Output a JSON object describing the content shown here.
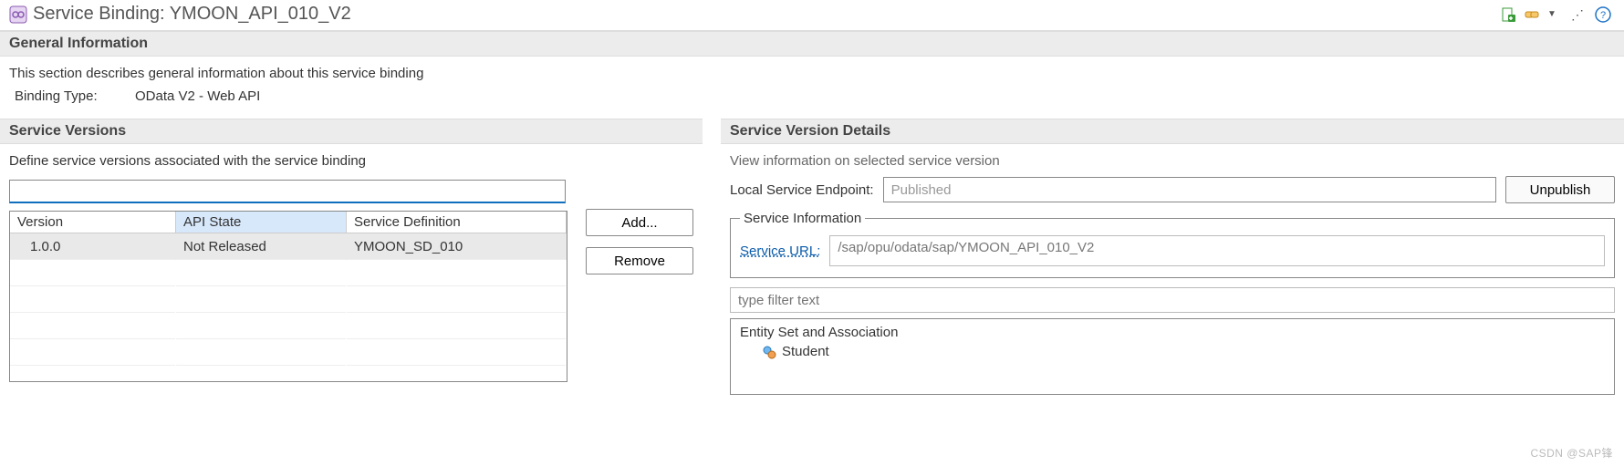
{
  "header": {
    "title": "Service Binding: YMOON_API_010_V2"
  },
  "general": {
    "section_title": "General Information",
    "description": "This section describes general information about this service binding",
    "binding_type_label": "Binding Type:",
    "binding_type_value": "OData V2 - Web API"
  },
  "versions": {
    "section_title": "Service Versions",
    "description": "Define service versions associated with the service binding",
    "filter_value": "",
    "columns": {
      "version": "Version",
      "api_state": "API State",
      "service_def": "Service Definition"
    },
    "rows": [
      {
        "version": "1.0.0",
        "api_state": "Not Released",
        "service_def": "YMOON_SD_010"
      }
    ],
    "add_label": "Add...",
    "remove_label": "Remove"
  },
  "details": {
    "section_title": "Service Version Details",
    "description": "View information on selected service version",
    "endpoint_label": "Local Service Endpoint:",
    "endpoint_value": "Published",
    "unpublish_label": "Unpublish",
    "service_info_legend": "Service Information",
    "service_url_label": "Service URL:",
    "service_url_value": "/sap/opu/odata/sap/YMOON_API_010_V2",
    "type_filter_placeholder": "type filter text",
    "entity_root": "Entity Set and Association",
    "entities": [
      "Student"
    ]
  },
  "watermark": "CSDN @SAP锋"
}
